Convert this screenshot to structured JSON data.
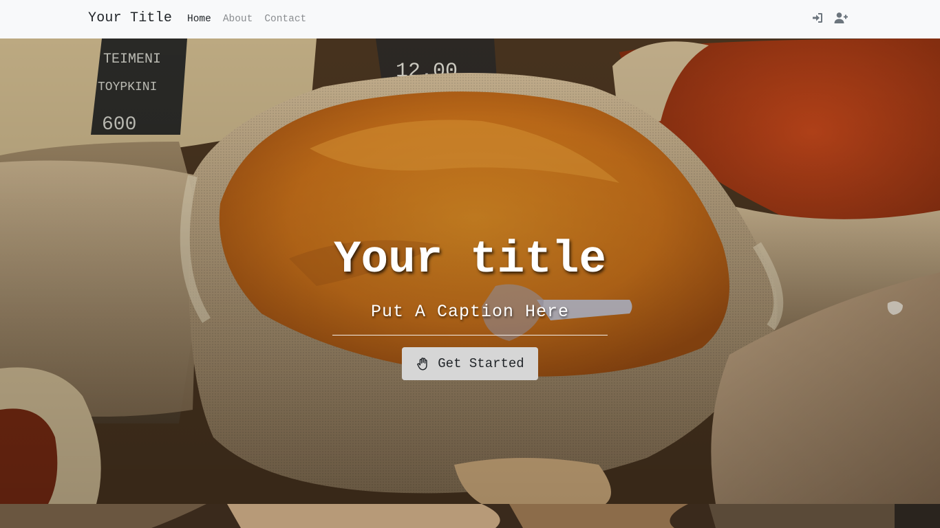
{
  "navbar": {
    "brand": "Your Title",
    "links": [
      {
        "label": "Home",
        "active": true
      },
      {
        "label": "About",
        "active": false
      },
      {
        "label": "Contact",
        "active": false
      }
    ],
    "icons": [
      "sign-in-icon",
      "user-plus-icon"
    ]
  },
  "hero": {
    "title": "Your title",
    "caption": "Put A Caption Here",
    "cta_label": "Get Started",
    "cta_icon": "hand-paper-icon"
  },
  "colors": {
    "navbar_bg": "#f8f9fa",
    "text_dark": "#212529",
    "text_muted": "#8a8d90",
    "button_bg": "#d6d6d6"
  }
}
